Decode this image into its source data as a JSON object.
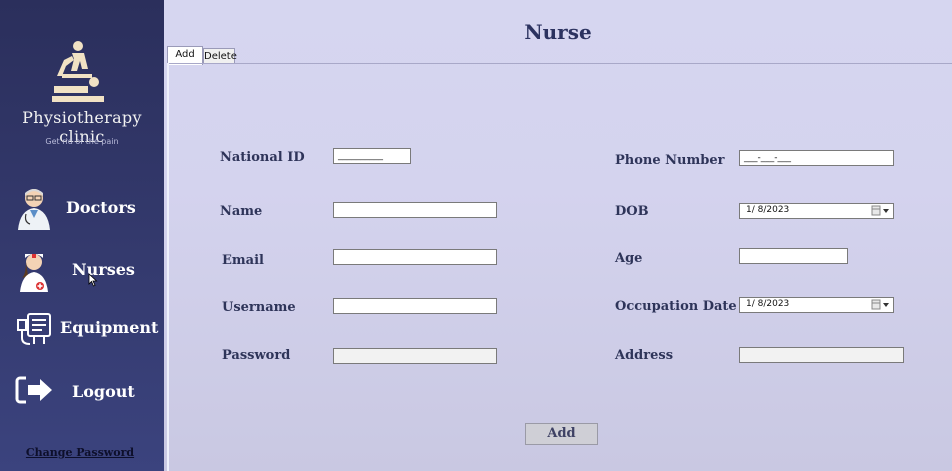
{
  "sidebar": {
    "brand_name": "Physiotherapy clinic",
    "tagline": "Get rid of the pain",
    "nav": [
      {
        "label": "Doctors",
        "icon": "doctor-icon"
      },
      {
        "label": "Nurses",
        "icon": "nurse-icon"
      },
      {
        "label": "Equipment",
        "icon": "equipment-icon"
      },
      {
        "label": "Logout",
        "icon": "logout-icon"
      }
    ],
    "change_password": "Change Password"
  },
  "main": {
    "title": "Nurse",
    "tabs": [
      {
        "label": "Add"
      },
      {
        "label": "Delete"
      }
    ],
    "fields": {
      "national_id": {
        "label": "National ID",
        "value": "__________"
      },
      "name": {
        "label": "Name",
        "value": ""
      },
      "email": {
        "label": "Email",
        "value": ""
      },
      "username": {
        "label": "Username",
        "value": ""
      },
      "password": {
        "label": "Password",
        "value": ""
      },
      "phone": {
        "label": "Phone Number",
        "value": "___-___-___"
      },
      "dob": {
        "label": "DOB",
        "value": "1/  8/2023"
      },
      "age": {
        "label": "Age",
        "value": ""
      },
      "occupation_date": {
        "label": "Occupation Date",
        "value": "1/  8/2023"
      },
      "address": {
        "label": "Address",
        "value": ""
      }
    },
    "add_button": "Add"
  },
  "colors": {
    "sidebar_bg": "#343a6e",
    "main_bg": "#d4d3ee",
    "label_text": "#2e3459"
  }
}
